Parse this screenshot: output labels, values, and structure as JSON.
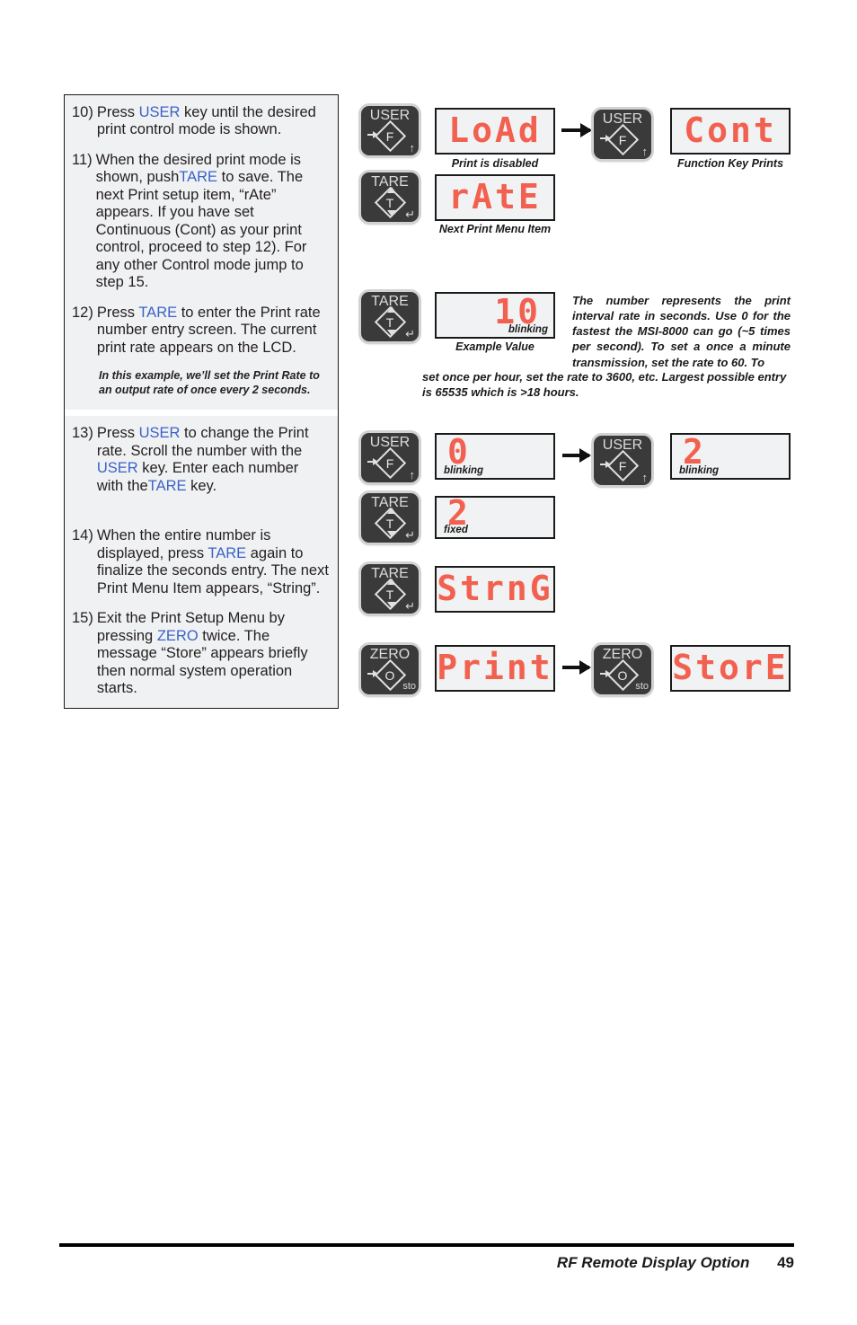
{
  "document": {
    "footer_title": "RF Remote Display Option",
    "page_number": "49"
  },
  "steps_panel": {
    "group_a": [
      {
        "number": "10)",
        "segments": [
          {
            "t": "Press ",
            "kw": false
          },
          {
            "t": "USER",
            "kw": true
          },
          {
            "t": " key until the desired print control mode is shown.",
            "kw": false
          }
        ],
        "text": "Press USER key until the desired print control mode is shown."
      },
      {
        "number": "11)",
        "text": "When the desired print mode is shown, push TARE  to save. The next Print setup item, “rAte” appears. If you have set Continuous (Cont) as your print control, proceed to step 12). For any other Control mode jump to step 15."
      },
      {
        "number": "12)",
        "text": "Press TARE to enter the Print rate number entry screen. The current print rate appears on the LCD."
      }
    ],
    "group_a_note": "In this example, we’ll set the Print Rate to an output rate of once every 2 seconds.",
    "group_b": [
      {
        "number": "13)",
        "text": "Press USER to change the Print rate. Scroll the number with the USER key. Enter each number with theTARE key."
      },
      {
        "number": "14)",
        "text": "When the entire number is displayed, press TARE again to finalize the seconds entry. The next Print Menu Item appears, “String”."
      },
      {
        "number": "15)",
        "text": "Exit the Print Setup Menu by pressing ZERO twice. The message “Store” appears briefly then normal system operation starts."
      }
    ]
  },
  "keys": {
    "user": {
      "label": "USER",
      "glyph": "F",
      "corner": "↑"
    },
    "tare": {
      "label": "TARE",
      "glyph": "T",
      "corner": "↵"
    },
    "zero": {
      "label": "ZERO",
      "glyph": "O",
      "corner": "sto"
    }
  },
  "diagram": {
    "row1": {
      "key1": "USER",
      "lcd1": "LoAd",
      "caption1": "Print is disabled",
      "key2": "USER",
      "lcd2": "Cont",
      "caption2": "Function Key Prints"
    },
    "row2": {
      "key1": "TARE",
      "lcd1": "rAtE",
      "caption1": "Next Print Menu Item"
    },
    "row3": {
      "key1": "TARE",
      "lcd1": "10",
      "tag1": "blinking",
      "caption1": "Example Value",
      "note": "The number represents the print interval rate in seconds. Use 0 for the fastest the MSI-8000 can go (~5 times per second). To set a once a minute transmission, set the rate to 60. To",
      "note_wide": "set once per hour, set the rate to 3600, etc. Largest possible entry is 65535 which is >18 hours."
    },
    "row4": {
      "key1": "USER",
      "lcd1": "0",
      "tag1": "blinking",
      "key2": "USER",
      "lcd2": "2",
      "tag2": "blinking"
    },
    "row5": {
      "key1": "TARE",
      "lcd1": "2",
      "tag1": "fixed"
    },
    "row6": {
      "key1": "TARE",
      "lcd1": "StrnG"
    },
    "row7": {
      "key1": "ZERO",
      "lcd1": "Print",
      "key2": "ZERO",
      "lcd2": "StorE"
    }
  },
  "colors": {
    "lcd_red": "#f2604f",
    "lcd_bg": "#f1f2f3",
    "keyword_blue": "#3a63c8",
    "panel_bg": "#f0f1f2",
    "key_body": "#3a3a3a"
  }
}
